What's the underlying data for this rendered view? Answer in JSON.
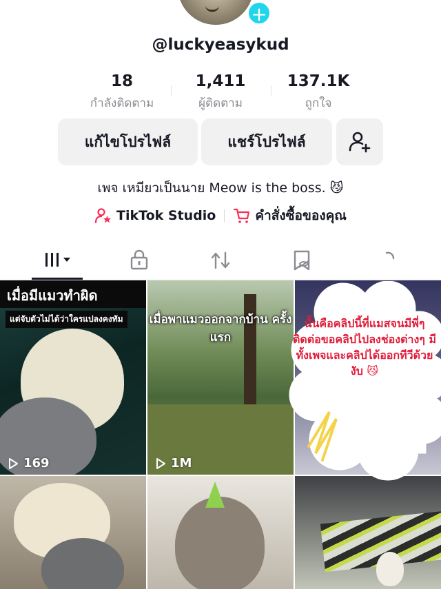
{
  "profile": {
    "username": "@luckyeasykud",
    "bio": "เพจ เหมียวเป็นนาย Meow is the boss. 😼"
  },
  "stats": [
    {
      "value": "18",
      "label": "กำลังติดตาม"
    },
    {
      "value": "1,411",
      "label": "ผู้ติดตาม"
    },
    {
      "value": "137.1K",
      "label": "ถูกใจ"
    }
  ],
  "buttons": {
    "edit_profile": "แก้ไขโปรไฟล์",
    "share_profile": "แชร์โปรไฟล์"
  },
  "links": {
    "studio": "TikTok Studio",
    "orders": "คำสั่งซื้อของคุณ"
  },
  "tabs": [
    "videos-grid",
    "private",
    "reposts",
    "favorites",
    "liked"
  ],
  "videos": [
    {
      "title": "เมื่อมีแมวทำผิด",
      "subtitle": "แต่จับตัวไม่ได้ว่าใครแปลงคงทัม",
      "views": "169"
    },
    {
      "title": "เมื่อพาแมวออกจากบ้าน ครั้งแรก",
      "views": "1M"
    },
    {
      "title": "",
      "views": ""
    },
    {
      "title": "",
      "views": ""
    },
    {
      "title": "",
      "views": ""
    },
    {
      "title": "",
      "views": ""
    }
  ],
  "annotation": "นั้นคือคลิปนี้ที่แมสจนมีพี่ๆติดต่อขอคลิปไปลงช่องต่างๆ มีทั้งเพจและคลิปได้ออกทีวีด้วยงับ 😼",
  "colors": {
    "accent_cyan": "#20d5ec",
    "tiktok_pink": "#fe2c55",
    "annotation_red": "#e11d3b"
  }
}
